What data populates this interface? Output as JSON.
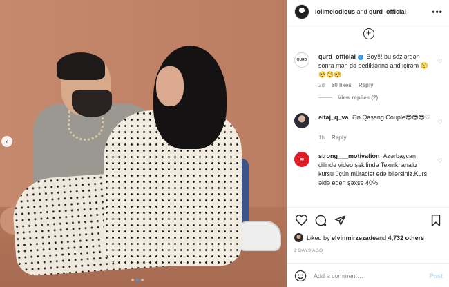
{
  "header": {
    "user1": "lolimelodious",
    "connector": " and ",
    "user2": "qurd_official",
    "more_icon": "more-horizontal-icon"
  },
  "comments": [
    {
      "username": "qurd_official",
      "verified": true,
      "avatar_text": "QURD",
      "text": "Boy!!! bu sözlərdən sonra mən də dediklərinə and içirəm 🥺🥺🥺🥺",
      "time": "2d",
      "likes": "80 likes",
      "reply": "Reply",
      "view_replies": "View replies (2)"
    },
    {
      "username": "aitaj_q_va",
      "text": "Ən Qaşang Couple😎😎😎♡",
      "time": "1h",
      "reply": "Reply"
    },
    {
      "username": "strong___motivation",
      "text": "Azərbaycan dilində video şəkilində Texniki analiz kursu üçün müraciət edə bilərsiniz.Kurs əldə eden şəxsə 40%"
    }
  ],
  "actions": {
    "liked_prefix": "Liked by ",
    "liked_user": "elvinmirzezade",
    "liked_mid": " and ",
    "liked_count": "4,732 others",
    "timestamp": "2 DAYS AGO"
  },
  "add_comment": {
    "placeholder": "Add a comment…",
    "post_label": "Post"
  },
  "carousel": {
    "prev_icon": "chevron-left-icon",
    "dots_total": 3,
    "active_dot": 2
  },
  "colors": {
    "accent_blue": "#3897f0",
    "post_disabled": "#b2dffc",
    "muted": "#8e8e8e",
    "backdrop": "#c1856a"
  }
}
